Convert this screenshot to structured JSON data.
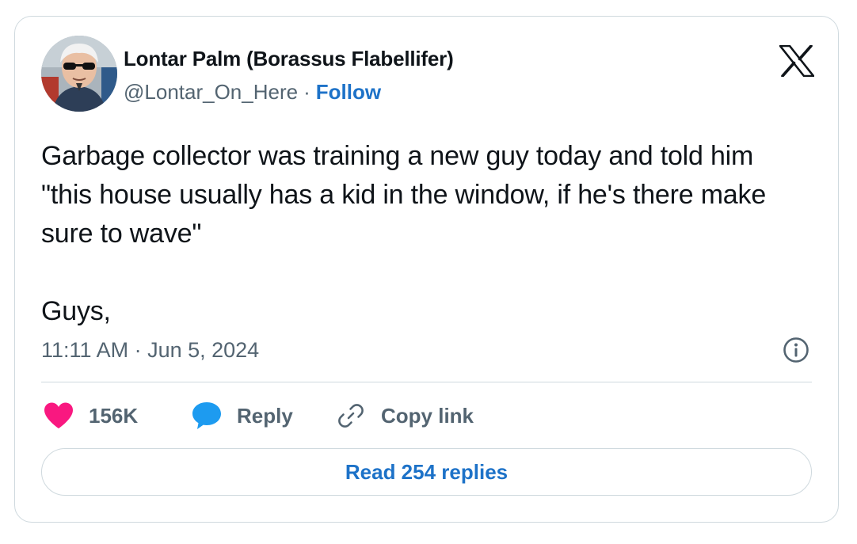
{
  "author": {
    "display_name": "Lontar Palm (Borassus Flabellifer)",
    "handle": "@Lontar_On_Here",
    "separator": "·",
    "follow_label": "Follow",
    "avatar_icon": "profile-photo-avatar"
  },
  "brand": {
    "logo_icon": "x-logo-icon"
  },
  "tweet": {
    "text": "Garbage collector was training a new guy today and told him \"this house usually has a kid in the window, if he's there make sure to wave\"\n\nGuys,",
    "timestamp": "11:11 AM · Jun 5, 2024"
  },
  "actions": {
    "like_count": "156K",
    "like_icon": "heart-icon",
    "reply_label": "Reply",
    "reply_icon": "speech-bubble-icon",
    "copy_link_label": "Copy link",
    "copy_link_icon": "link-icon",
    "info_icon": "info-icon"
  },
  "footer": {
    "read_replies_label": "Read 254 replies"
  },
  "colors": {
    "link_blue": "#1d72c8",
    "like_pink": "#f91880",
    "reply_blue": "#1d9bf0",
    "muted_text": "#536471",
    "border": "#cfd9de"
  }
}
